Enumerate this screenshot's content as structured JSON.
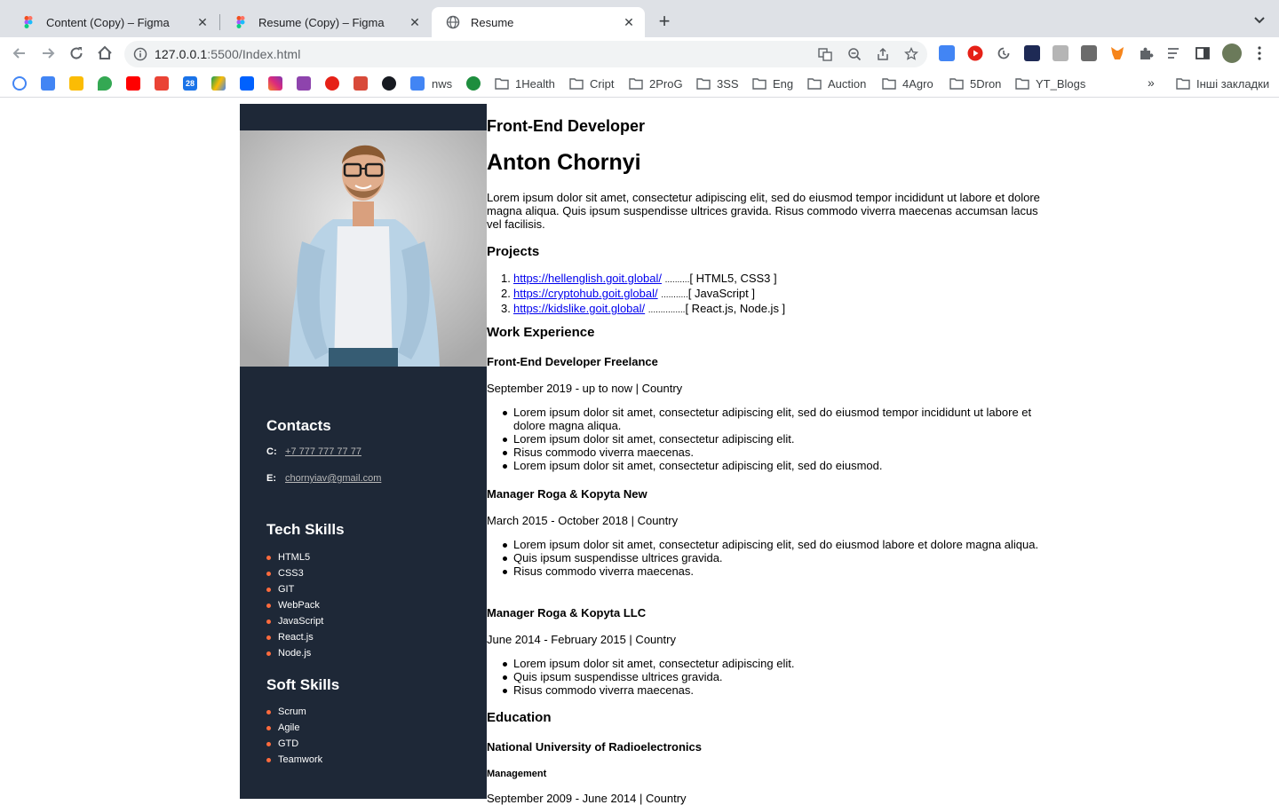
{
  "browser": {
    "tabs": [
      {
        "title": "Content (Copy) – Figma",
        "icon": "figma-icon",
        "active": false
      },
      {
        "title": "Resume (Copy) – Figma",
        "icon": "figma-icon",
        "active": false
      },
      {
        "title": "Resume",
        "icon": "globe-icon",
        "active": true
      }
    ],
    "url_host": "127.0.0.1",
    "url_rest": ":5500/Index.html",
    "bookmarks": [
      "nws",
      "1Health",
      "Cript",
      "2ProG",
      "3SS",
      "Eng",
      "Auction",
      "4Agro",
      "5Dron",
      "YT_Blogs"
    ],
    "other_bookmarks": "Інші закладки",
    "calendar_day": "28"
  },
  "resume": {
    "role": "Front-End Developer",
    "name": "Anton Chornyi",
    "intro": "Lorem ipsum dolor sit amet, consectetur adipiscing elit, sed do eiusmod tempor incididunt ut labore et dolore magna aliqua. Quis ipsum suspendisse ultrices gravida. Risus commodo viverra maecenas accumsan lacus vel facilisis.",
    "projects_title": "Projects",
    "projects": [
      {
        "num": "1.",
        "url": "https://hellenglish.goit.global/",
        "dots": "..........",
        "tech": "[ HTML5, CSS3 ]"
      },
      {
        "num": "2.",
        "url": "https://cryptohub.goit.global/",
        "dots": "...........",
        "tech": "[ JavaScript ]"
      },
      {
        "num": "3.",
        "url": "https://kidslike.goit.global/",
        "dots": "...............",
        "tech": "[ React.js, Node.js ]"
      }
    ],
    "work_title": "Work Experience",
    "jobs": [
      {
        "title": "Front-End Developer Freelance",
        "period": "September 2019 - up to now | Country",
        "items": [
          "Lorem ipsum dolor sit amet, consectetur adipiscing elit, sed do eiusmod tempor incididunt ut labore et dolore magna aliqua.",
          "Lorem ipsum dolor sit amet, consectetur adipiscing elit.",
          "Risus commodo viverra maecenas.",
          "Lorem ipsum dolor sit amet, consectetur adipiscing elit, sed do eiusmod."
        ]
      },
      {
        "title": "Manager Roga & Kopyta New",
        "period": "March 2015 - October 2018 | Country",
        "items": [
          "Lorem ipsum dolor sit amet, consectetur adipiscing elit, sed do eiusmod labore et dolore magna aliqua.",
          "Quis ipsum suspendisse ultrices gravida.",
          "Risus commodo viverra maecenas."
        ]
      },
      {
        "title": "Manager Roga & Kopyta LLC",
        "period": "June 2014 - February 2015 | Country",
        "items": [
          "Lorem ipsum dolor sit amet, consectetur adipiscing elit.",
          "Quis ipsum suspendisse ultrices gravida.",
          "Risus commodo viverra maecenas."
        ]
      }
    ],
    "education_title": "Education",
    "university": "National University of Radioelectronics",
    "faculty": "Management",
    "edu_period": "September 2009 - June 2014 | Country",
    "sidebar": {
      "contacts_title": "Contacts",
      "phone_label": "C:",
      "phone": "+7 777 777 77 77",
      "email_label": "E:",
      "email": "chornyiav@gmail.com",
      "tech_title": "Tech Skills",
      "tech": [
        "HTML5",
        "CSS3",
        "GIT",
        "WebPack",
        "JavaScript",
        "React.js",
        "Node.js"
      ],
      "soft_title": "Soft Skills",
      "soft": [
        "Scrum",
        "Agile",
        "GTD",
        "Teamwork"
      ]
    }
  }
}
